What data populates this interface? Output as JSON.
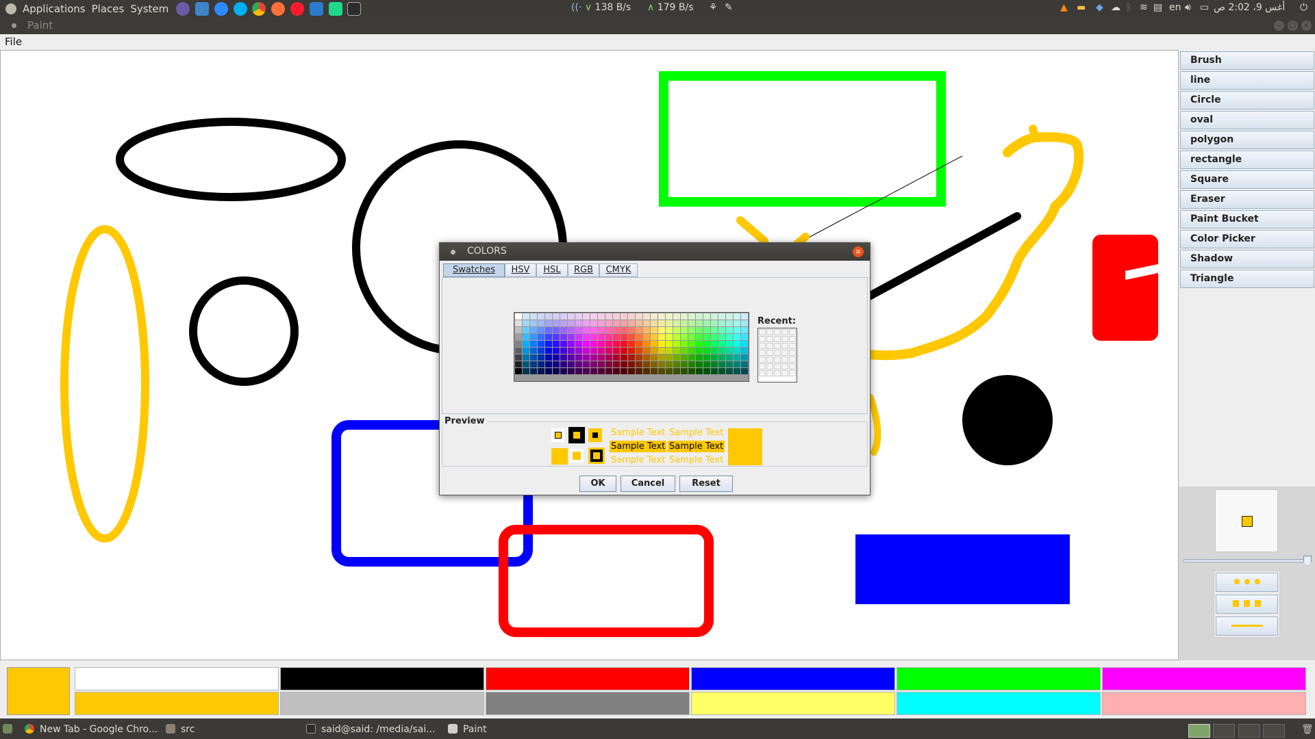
{
  "top_panel": {
    "menus": [
      "Applications",
      "Places",
      "System"
    ],
    "net_down": "138 B/s",
    "net_up": "179 B/s",
    "language": "en",
    "clock": "أغس 9، 2:02 ص",
    "launchers": [
      "eclipse-icon",
      "virtualbox-icon",
      "zoom-icon",
      "skype-icon",
      "chrome-icon",
      "firefox-icon",
      "opera-icon",
      "vscode-icon",
      "pycharm-icon",
      "terminal-icon"
    ]
  },
  "window": {
    "title": "Paint"
  },
  "menubar": {
    "file": "File"
  },
  "tools": [
    "Brush",
    "line",
    "Circle",
    "oval",
    "polygon",
    "rectangle",
    "Square",
    "Eraser",
    "Paint Bucket",
    "Color Picker",
    "Shadow",
    "Triangle"
  ],
  "palette": {
    "current": "#ffc800",
    "top_row": [
      "#ffffff",
      "#000000",
      "#ff0000",
      "#0000ff",
      "#00ff00",
      "#ff00ff"
    ],
    "bottom_row": [
      "#ffc800",
      "#c0c0c0",
      "#808080",
      "#ffff66",
      "#00ffff",
      "#ffafaf"
    ]
  },
  "dialog": {
    "title": "COLORS",
    "tabs": [
      "Swatches",
      "HSV",
      "HSL",
      "RGB",
      "CMYK"
    ],
    "active_tab": "Swatches",
    "recent_label": "Recent:",
    "preview_label": "Preview",
    "sample_text": "Sample Text",
    "selected_color": "#ffc800",
    "buttons": {
      "ok": "OK",
      "cancel": "Cancel",
      "reset": "Reset"
    }
  },
  "taskbar": {
    "items": [
      "New Tab - Google Chro...",
      "src",
      "said@said: /media/sai...",
      "Paint"
    ]
  }
}
